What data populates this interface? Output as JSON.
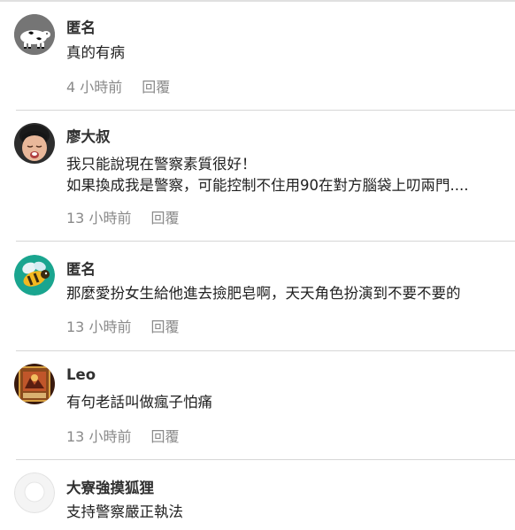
{
  "comments": [
    {
      "author": "匿名",
      "avatar_icon": "cow-icon",
      "lines": [
        "真的有病"
      ],
      "time": "4 小時前",
      "reply_label": "回覆"
    },
    {
      "author": "廖大叔",
      "avatar_icon": "child-photo-avatar",
      "lines": [
        "我只能說現在警察素質很好！",
        "如果換成我是警察，可能控制不住用90在對方腦袋上叨兩門...."
      ],
      "time": "13 小時前",
      "reply_label": "回覆"
    },
    {
      "author": "匿名",
      "avatar_icon": "bee-icon",
      "lines": [
        "那麼愛扮女生給他進去撿肥皂啊，天天角色扮演到不要不要的"
      ],
      "time": "13 小時前",
      "reply_label": "回覆"
    },
    {
      "author": "Leo",
      "avatar_icon": "card-art-avatar",
      "lines": [
        "有句老話叫做瘋子怕痛"
      ],
      "time": "13 小時前",
      "reply_label": "回覆"
    },
    {
      "author": "大寮強摸狐狸",
      "avatar_icon": "default-user-icon",
      "lines": [
        "支持警察嚴正執法"
      ]
    }
  ]
}
